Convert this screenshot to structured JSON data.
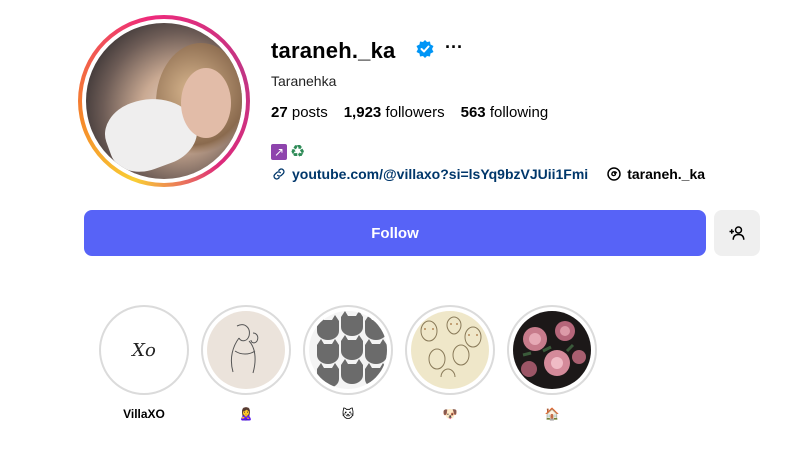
{
  "profile": {
    "username": "taraneh._ka",
    "full_name": "Taranehka",
    "verified": true,
    "stats": {
      "posts_count": "27",
      "posts_label": "posts",
      "followers_count": "1,923",
      "followers_label": "followers",
      "following_count": "563",
      "following_label": "following"
    },
    "bio_emojis": [
      "↗",
      "♻"
    ],
    "link": "youtube.com/@villaxo?si=lsYq9bzVJUii1Fmi",
    "threads_handle": "taraneh._ka",
    "more_label": "···"
  },
  "actions": {
    "follow_label": "Follow"
  },
  "highlights": [
    {
      "label": "VillaXO",
      "cover_text": "Xo"
    },
    {
      "label": "🙎‍♀️"
    },
    {
      "label": "🐱"
    },
    {
      "label": "🐶"
    },
    {
      "label": "🏠"
    }
  ],
  "colors": {
    "accent": "#5763f7",
    "link": "#00376b",
    "verified": "#0095f6"
  }
}
